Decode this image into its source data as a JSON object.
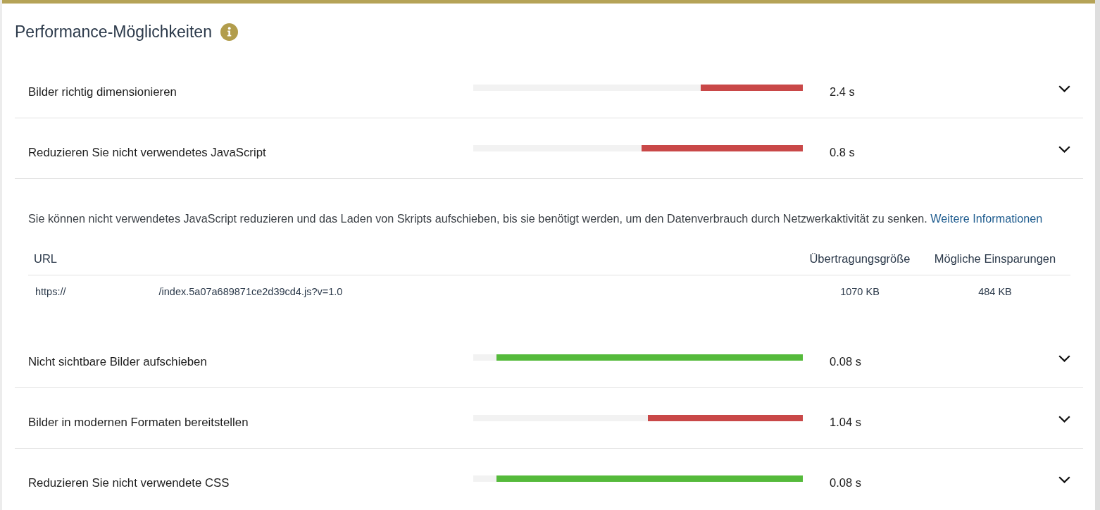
{
  "title": "Performance-Möglichkeiten",
  "audits": [
    {
      "label": "Bilder richtig dimensionieren",
      "level": 0.31,
      "color": "#c94848",
      "reading": "2.4 s"
    },
    {
      "label": "Reduzieren Sie nicht verwendetes JavaScript",
      "level": 0.49,
      "color": "#c94848",
      "reading": "0.8 s",
      "details": {
        "description": "Sie können nicht verwendetes JavaScript reduzieren und das Laden von Skripts aufschieben, bis sie benötigt werden, um den Datenverbrauch durch Netzwerkaktivität zu senken.",
        "link": "Weitere Informationen",
        "table": {
          "columns": [
            "URL",
            "Übertragungsgröße",
            "Mögliche Einsparungen"
          ],
          "rows": [
            {
              "url_start": "https://",
              "url_end": "/index.5a07a689871ce2d39cd4.js?v=1.0",
              "transfer_size": "1070 KB",
              "savings": "484 KB"
            }
          ]
        }
      }
    },
    {
      "label": "Nicht sichtbare Bilder aufschieben",
      "level": 0.93,
      "color": "#55ba3b",
      "reading": "0.08 s"
    },
    {
      "label": "Bilder in modernen Formaten bereitstellen",
      "level": 0.47,
      "color": "#c94848",
      "reading": "1.04 s"
    },
    {
      "label": "Reduzieren Sie nicht verwendete CSS",
      "level": 0.93,
      "color": "#55ba3b",
      "reading": "0.08 s"
    }
  ]
}
